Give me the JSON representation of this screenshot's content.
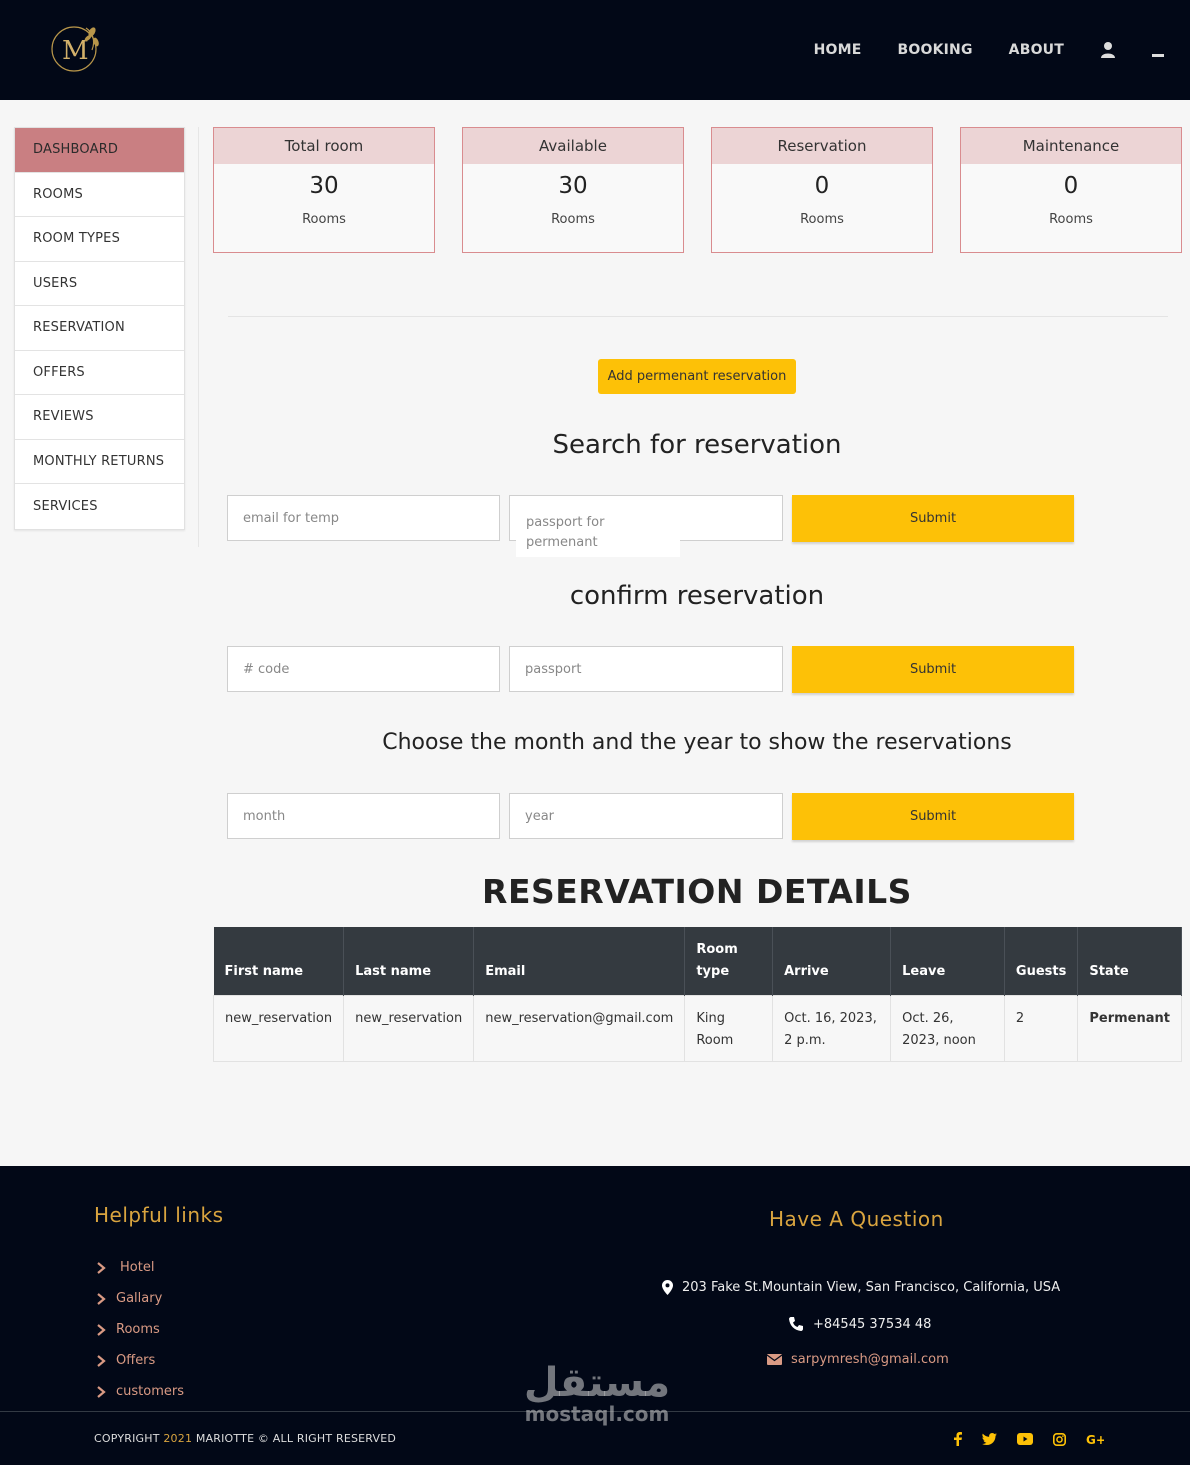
{
  "header": {
    "nav": [
      "HOME",
      "BOOKING",
      "ABOUT"
    ],
    "logo_letter": "M"
  },
  "sidebar": {
    "items": [
      {
        "label": "DASHBOARD",
        "active": true
      },
      {
        "label": "ROOMS"
      },
      {
        "label": "ROOM TYPES"
      },
      {
        "label": "USERS"
      },
      {
        "label": "RESERVATION"
      },
      {
        "label": "OFFERS"
      },
      {
        "label": "REVIEWS"
      },
      {
        "label": "MONTHLY RETURNS"
      },
      {
        "label": "SERVICES"
      }
    ]
  },
  "stats": [
    {
      "title": "Total room",
      "value": "30",
      "unit": "Rooms"
    },
    {
      "title": "Available",
      "value": "30",
      "unit": "Rooms"
    },
    {
      "title": "Reservation",
      "value": "0",
      "unit": "Rooms"
    },
    {
      "title": "Maintenance",
      "value": "0",
      "unit": "Rooms"
    }
  ],
  "add_button": "Add permenant reservation",
  "search": {
    "title": "Search for reservation",
    "email_placeholder": "email for temp",
    "passport_placeholder": "passport for\npermenant",
    "passport_overflow": "permenant",
    "submit": "Submit"
  },
  "confirm": {
    "title": "confirm reservation",
    "code_placeholder": "# code",
    "passport_placeholder": "passport",
    "submit": "Submit"
  },
  "month_filter": {
    "title": "Choose the month and the year to show the reservations",
    "month_placeholder": "month",
    "year_placeholder": "year",
    "submit": "Submit"
  },
  "details": {
    "title": "RESERVATION DETAILS",
    "columns": [
      "First name",
      "Last name",
      "Email",
      "Room type",
      "Arrive",
      "Leave",
      "Guests",
      "State"
    ],
    "rows": [
      [
        "new_reservation",
        "new_reservation",
        "new_reservation@gmail.com",
        "King Room",
        "Oct. 16, 2023, 2 p.m.",
        "Oct. 26, 2023, noon",
        "2",
        "Permenant"
      ]
    ]
  },
  "footer": {
    "links_title": "Helpful links",
    "links": [
      "Hotel",
      "Gallary",
      "Rooms",
      "Offers",
      "customers"
    ],
    "question_title": "Have A Question",
    "address": "203 Fake St.Mountain View, San Francisco, California, USA",
    "phone": "+84545 37534 48",
    "email": "sarpymresh@gmail.com",
    "copyright_pre": "COPYRIGHT",
    "copyright_year": "2021",
    "copyright_post": "MARIOTTE © ALL RIGHT RESERVED",
    "socials": [
      "facebook-icon",
      "twitter-icon",
      "youtube-icon",
      "instagram-icon",
      "google-plus-icon"
    ]
  },
  "watermark": {
    "arabic": "مستقل",
    "latin": "mostaql.com"
  },
  "colors": {
    "accent": "#fdc107",
    "header_bg": "#020817",
    "sidebar_active": "#c97f82",
    "gold": "#d9a43f"
  }
}
